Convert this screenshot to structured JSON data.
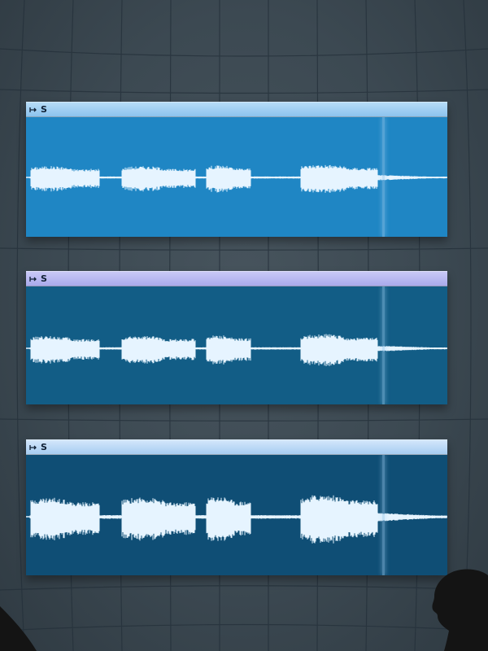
{
  "regions": [
    {
      "name": "S",
      "header_color": "#a8d2f4",
      "body_color": "#1f86c4"
    },
    {
      "name": "S",
      "header_color": "#b9baf1",
      "body_color": "#125d86"
    },
    {
      "name": "S",
      "header_color": "#bfdaf7",
      "body_color": "#0f4e75"
    }
  ],
  "region_icon": "loop-arrow-icon",
  "waveform_color": "#e6f4ff",
  "playhead_color": "#9fd0f0"
}
